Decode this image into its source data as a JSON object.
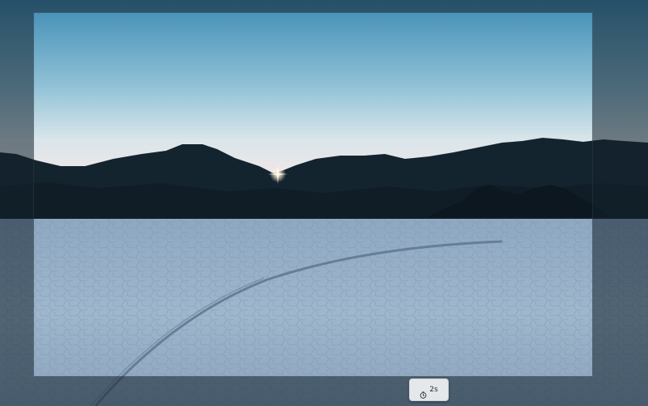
{
  "screenshot_tool": {
    "delay_button": {
      "icon": "timer-icon",
      "label": "2s"
    }
  },
  "colors": {
    "sky_top": "#3f8db5",
    "sky_horizon": "#f3e6e8",
    "mountains": "#13232f",
    "playa": "#9cb4cc",
    "overlay": "#12202c",
    "button_bg": "#e4e8ea"
  }
}
